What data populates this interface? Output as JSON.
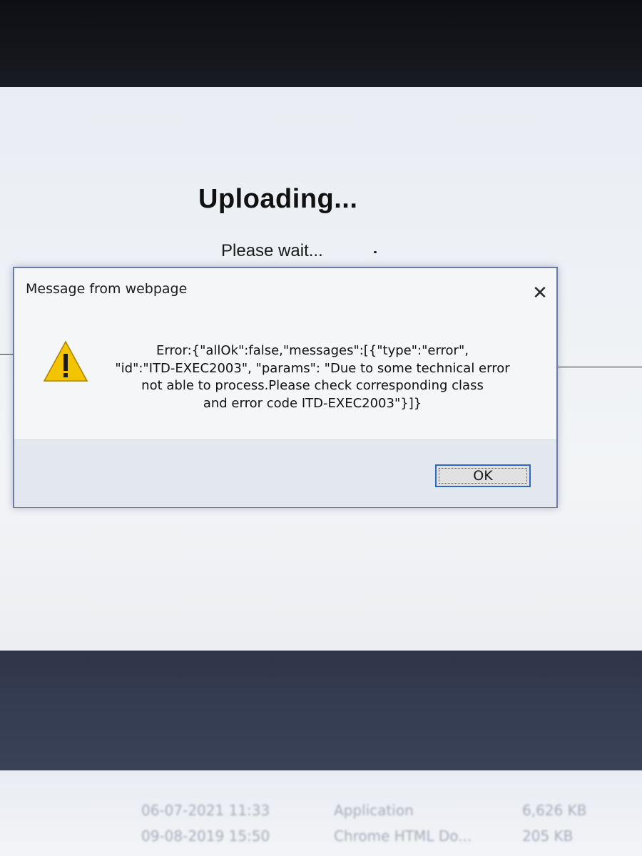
{
  "page": {
    "title": "Uploading...",
    "subtitle": "Please wait..."
  },
  "dialog": {
    "title": "Message from webpage",
    "close_icon": "close-icon",
    "warning_icon": "warning-icon",
    "message": "Error:{\"allOk\":false,\"messages\":[{\"type\":\"error\",\n\"id\":\"ITD-EXEC2003\", \"params\": \"Due to some technical error\nnot able to process.Please check corresponding class\nand error code ITD-EXEC2003\"}]}",
    "ok_label": "OK"
  },
  "explorer": {
    "rows": [
      {
        "date": "06-07-2021 11:33",
        "type": "Application",
        "size": "6,626 KB"
      },
      {
        "date": "09-08-2019 15:50",
        "type": "Chrome HTML Do...",
        "size": "205 KB"
      }
    ]
  },
  "colors": {
    "dialog_border": "#6b7aa8",
    "ok_focus": "#2f67c9",
    "warning_fill": "#f5c400"
  }
}
